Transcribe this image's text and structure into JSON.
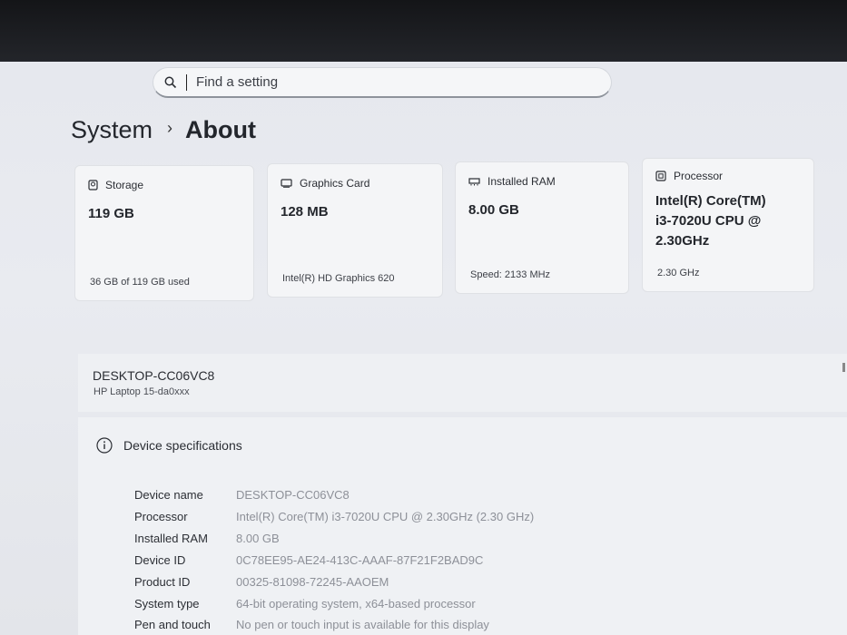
{
  "search": {
    "placeholder": "Find a setting"
  },
  "breadcrumb": {
    "parent": "System",
    "current": "About"
  },
  "cards": {
    "storage": {
      "title": "Storage",
      "value": "119 GB",
      "sub": "36 GB of 119 GB used",
      "icon": "storage-icon"
    },
    "graphics": {
      "title": "Graphics Card",
      "value": "128 MB",
      "sub": "Intel(R) HD Graphics 620",
      "icon": "graphics-card-icon"
    },
    "ram": {
      "title": "Installed RAM",
      "value": "8.00 GB",
      "sub": "Speed: 2133 MHz",
      "icon": "ram-icon"
    },
    "processor": {
      "title": "Processor",
      "value_line1": "Intel(R) Core(TM)",
      "value_line2": "i3-7020U CPU @",
      "value_line3": "2.30GHz",
      "sub": "2.30 GHz",
      "icon": "processor-icon"
    }
  },
  "device": {
    "name": "DESKTOP-CC06VC8",
    "model": "HP Laptop 15-da0xxx"
  },
  "specs": {
    "title": "Device specifications",
    "rows": [
      {
        "label": "Device name",
        "value": "DESKTOP-CC06VC8"
      },
      {
        "label": "Processor",
        "value": "Intel(R) Core(TM) i3-7020U CPU @ 2.30GHz (2.30 GHz)"
      },
      {
        "label": "Installed RAM",
        "value": "8.00 GB"
      },
      {
        "label": "Device ID",
        "value": "0C78EE95-AE24-413C-AAAF-87F21F2BAD9C"
      },
      {
        "label": "Product ID",
        "value": "00325-81098-72245-AAOEM"
      },
      {
        "label": "System type",
        "value": "64-bit operating system, x64-based processor"
      },
      {
        "label": "Pen and touch",
        "value": "No pen or touch input is available for this display"
      }
    ]
  }
}
